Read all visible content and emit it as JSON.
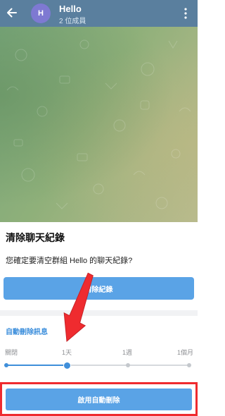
{
  "header": {
    "avatar_letter": "H",
    "title": "Hello",
    "subtitle": "2 位成員"
  },
  "sheet": {
    "title": "清除聊天紀錄",
    "message": "您確定要清空群組 Hello 的聊天紀錄?",
    "clear_button": "清除紀錄"
  },
  "auto_delete": {
    "label": "自動刪除訊息",
    "options": [
      "關閉",
      "1天",
      "1週",
      "1個月"
    ],
    "selected_index": 1,
    "enable_button": "啟用自動刪除"
  },
  "colors": {
    "header_bg": "#5a7f9e",
    "accent": "#3f8fda",
    "button_bg": "#5aa3e6",
    "highlight": "#ef2b2f"
  },
  "icons": [
    "back-arrow-icon",
    "more-vertical-icon"
  ]
}
